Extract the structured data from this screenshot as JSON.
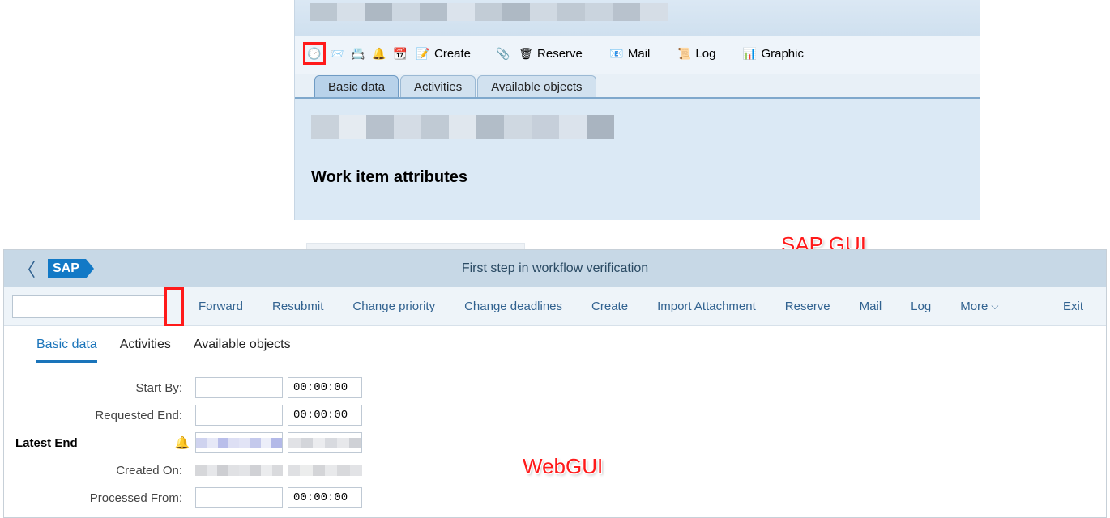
{
  "sapgui": {
    "toolbar": {
      "create": "Create",
      "reserve": "Reserve",
      "mail": "Mail",
      "log": "Log",
      "graphic": "Graphic"
    },
    "tabs": {
      "basic_data": "Basic data",
      "activities": "Activities",
      "available_objects": "Available objects"
    },
    "section_title": "Work item attributes"
  },
  "annotations": {
    "sapgui": "SAP GUI",
    "webgui": "WebGUI"
  },
  "webgui": {
    "logo": "SAP",
    "header_title": "First step in workflow verification",
    "actions": {
      "forward": "Forward",
      "resubmit": "Resubmit",
      "change_priority": "Change priority",
      "change_deadlines": "Change deadlines",
      "create": "Create",
      "import_attachment": "Import Attachment",
      "reserve": "Reserve",
      "mail": "Mail",
      "log": "Log",
      "more": "More",
      "exit": "Exit"
    },
    "tabs": {
      "basic_data": "Basic data",
      "activities": "Activities",
      "available_objects": "Available objects"
    },
    "form": {
      "start_by": {
        "label": "Start By:",
        "date": "",
        "time": "00:00:00"
      },
      "requested_end": {
        "label": "Requested End:",
        "date": "",
        "time": "00:00:00"
      },
      "latest_end": {
        "label": "Latest End",
        "date": "",
        "time": ""
      },
      "created_on": {
        "label": "Created On:",
        "date": "",
        "time": ""
      },
      "processed_from": {
        "label": "Processed From:",
        "date": "",
        "time": "00:00:00"
      }
    }
  }
}
